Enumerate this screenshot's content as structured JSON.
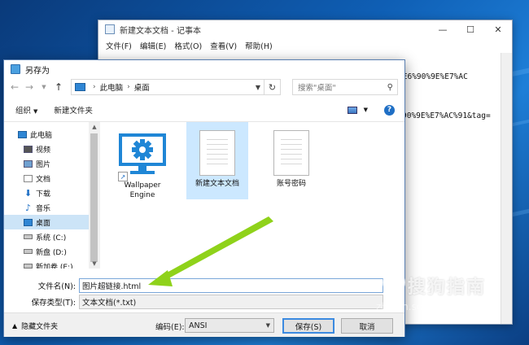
{
  "notepad": {
    "title": "新建文本文档 - 记事本",
    "controls": {
      "minimize": "—",
      "maximize": "☐",
      "close": "✕"
    },
    "menus": [
      "文件(F)",
      "编辑(E)",
      "格式(O)",
      "查看(V)",
      "帮助(H)"
    ],
    "text_line1": "<a href=\"http://pic.sogou.com/pics/recompic/detail.jsp?category=%E6%90%9E%E7%AC",
    "text_line2": "90%9E%E7%AC%91&tag="
  },
  "dialog": {
    "title": "另存为",
    "address": {
      "root": "此电脑",
      "current": "桌面"
    },
    "search_placeholder": "搜索\"桌面\"",
    "toolbar": {
      "organize": "组织",
      "new_folder": "新建文件夹"
    },
    "nav": {
      "this_pc": "此电脑",
      "items": [
        "视频",
        "图片",
        "文档",
        "下载",
        "音乐",
        "桌面",
        "系统 (C:)",
        "新盘 (D:)",
        "新加卷 (E:)"
      ]
    },
    "files": [
      {
        "name": "Wallpaper Engine",
        "name_line1": "Wallpaper",
        "name_line2": "Engine"
      },
      {
        "name": "新建文本文档"
      },
      {
        "name": "账号密码"
      }
    ],
    "filename_label": "文件名(N):",
    "filename_value": "图片超链接.html",
    "filetype_label": "保存类型(T):",
    "filetype_value": "文本文档(*.txt)",
    "hide_folders": "隐藏文件夹",
    "encoding_label": "编码(E):",
    "encoding_value": "ANSI",
    "save_button": "保存(S)",
    "cancel_button": "取消"
  },
  "watermark": {
    "main": "搜狗指南",
    "sub": "zhinan.sogou.com"
  },
  "colors": {
    "accent": "#1f6fc5",
    "selection": "#cce8ff",
    "arrow": "#8fd21a"
  }
}
